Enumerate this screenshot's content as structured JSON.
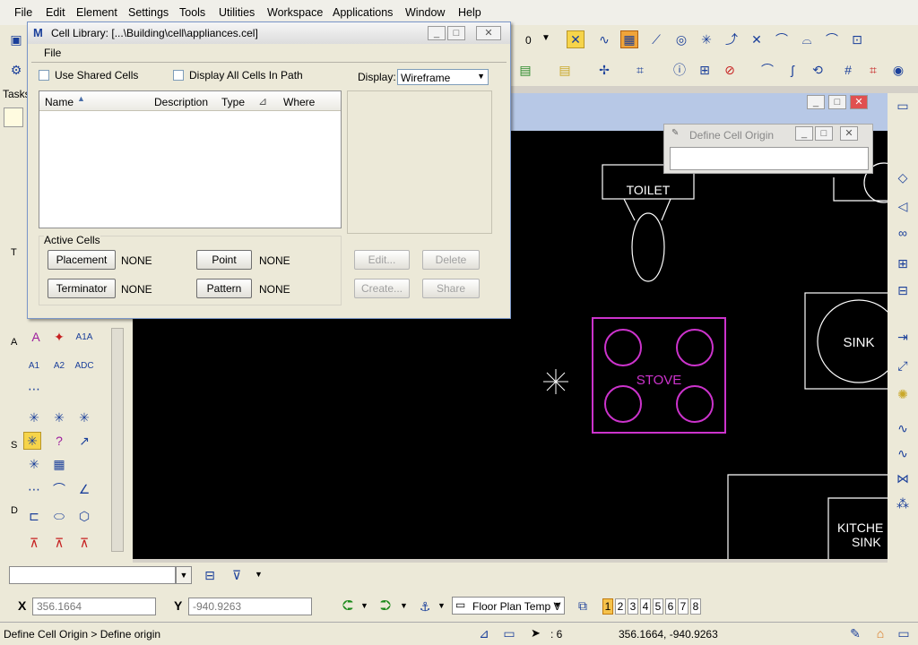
{
  "menu": [
    "File",
    "Edit",
    "Element",
    "Settings",
    "Tools",
    "Utilities",
    "Workspace",
    "Applications",
    "Window",
    "Help"
  ],
  "toolbar": {
    "level_value": "0"
  },
  "tasks": {
    "label": "Tasks",
    "section_letters": [
      "T",
      "A",
      "S",
      "D"
    ]
  },
  "cell_library": {
    "title": "Cell Library: [...\\Building\\cell\\appliances.cel]",
    "menu_file": "File",
    "use_shared_cells": "Use Shared Cells",
    "display_all_cells": "Display All Cells In Path",
    "display_label": "Display:",
    "display_value": "Wireframe",
    "columns": [
      "Name",
      "Description",
      "Type",
      "Where"
    ],
    "active_cells_label": "Active Cells",
    "placement_button": "Placement",
    "placement_value": "NONE",
    "point_button": "Point",
    "point_value": "NONE",
    "terminator_button": "Terminator",
    "terminator_value": "NONE",
    "pattern_button": "Pattern",
    "pattern_value": "NONE",
    "edit_button": "Edit...",
    "delete_button": "Delete",
    "create_button": "Create...",
    "share_button": "Share"
  },
  "define_cell_origin": {
    "title": "Define Cell Origin"
  },
  "drawing": {
    "toilet_label": "TOILET",
    "stove_label": "STOVE",
    "sink_label": "SINK",
    "kitchen_sink_line1": "KITCHE",
    "kitchen_sink_line2": "SINK",
    "stove_color": "#cc33cc",
    "line_color": "#ffffff"
  },
  "coords": {
    "x_label": "X",
    "x_value": "356.1664",
    "y_label": "Y",
    "y_value": "-940.9263",
    "view_attr": "Floor Plan Temp V",
    "views": [
      "1",
      "2",
      "3",
      "4",
      "5",
      "6",
      "7",
      "8"
    ],
    "active_view": "1"
  },
  "status": {
    "prompt": "Define Cell Origin > Define origin",
    "selection_count": ": 6",
    "cursor_coords": "356.1664, -940.9263"
  }
}
